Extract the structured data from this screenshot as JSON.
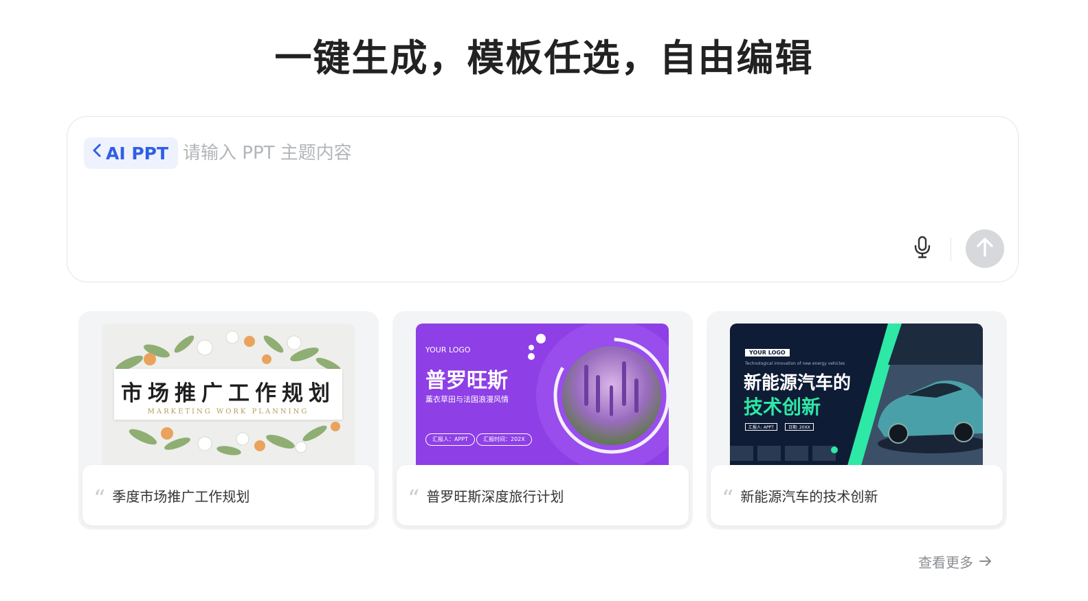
{
  "header": {
    "title": "一键生成，模板任选，自由编辑"
  },
  "composer": {
    "mode_label": "AI PPT",
    "placeholder": "请输入 PPT 主题内容",
    "icons": [
      "chevron-left-icon",
      "microphone-icon",
      "arrow-up-icon"
    ]
  },
  "cards": [
    {
      "caption": "季度市场推广工作规划",
      "thumb": {
        "title": "市场推广工作规划",
        "subtitle": "MARKETING WORK PLANNING"
      }
    },
    {
      "caption": "普罗旺斯深度旅行计划",
      "thumb": {
        "logo": "YOUR LOGO",
        "title": "普罗旺斯",
        "subtitle": "薰衣草田与法国浪漫风情",
        "tag_reporter": "汇报人：APPT",
        "tag_time": "汇报时间：202X"
      }
    },
    {
      "caption": "新能源汽车的技术创新",
      "thumb": {
        "logo": "YOUR LOGO",
        "tagline": "Technological innovation of new energy vehicles",
        "title_line1": "新能源汽车的",
        "title_line2": "技术创新",
        "meta_reporter": "汇报人: APPT",
        "meta_date": "日期: 20XX"
      }
    }
  ],
  "footer": {
    "see_more": "查看更多"
  },
  "colors": {
    "accent": "#2f5fe6",
    "chip_bg": "#eef2fd",
    "send_disabled": "#d6d8dc",
    "card_bg": "#f3f4f6",
    "purple": "#8e3fe6",
    "navy": "#0f1c36",
    "green": "#2ee8a6"
  }
}
